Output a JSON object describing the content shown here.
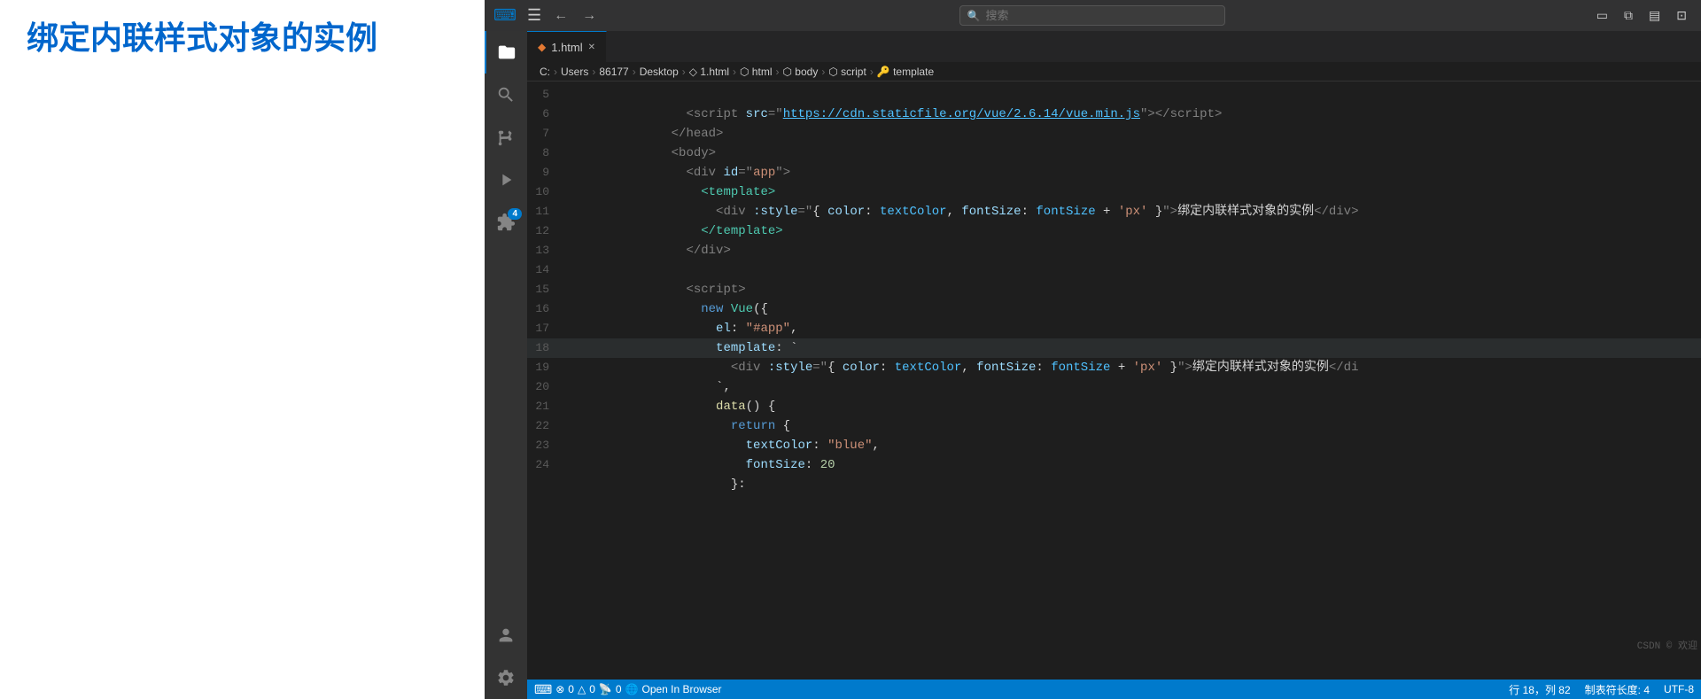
{
  "title": {
    "text": "绑定内联样式对象的实例"
  },
  "vscode": {
    "tab": {
      "icon": "◆",
      "label": "1.html",
      "close": "✕"
    },
    "breadcrumb": {
      "parts": [
        "C:",
        "Users",
        "86177",
        "Desktop",
        "1.html",
        "html",
        "body",
        "script",
        "template"
      ]
    },
    "search": {
      "placeholder": "搜索"
    },
    "lines": [
      {
        "num": 5,
        "content": ""
      },
      {
        "num": 6,
        "content": ""
      },
      {
        "num": 7,
        "content": ""
      },
      {
        "num": 8,
        "content": ""
      },
      {
        "num": 9,
        "content": ""
      },
      {
        "num": 10,
        "content": ""
      },
      {
        "num": 11,
        "content": ""
      },
      {
        "num": 12,
        "content": ""
      },
      {
        "num": 13,
        "content": ""
      },
      {
        "num": 14,
        "content": ""
      },
      {
        "num": 15,
        "content": ""
      },
      {
        "num": 16,
        "content": ""
      },
      {
        "num": 17,
        "content": ""
      },
      {
        "num": 18,
        "content": ""
      },
      {
        "num": 19,
        "content": ""
      },
      {
        "num": 20,
        "content": ""
      },
      {
        "num": 21,
        "content": ""
      },
      {
        "num": 22,
        "content": ""
      },
      {
        "num": 23,
        "content": ""
      },
      {
        "num": 24,
        "content": ""
      }
    ],
    "statusbar": {
      "errors": "0",
      "warnings": "0",
      "info": "0",
      "ports": "0",
      "openInBrowser": "Open In Browser",
      "row": "行 18，列 82",
      "tabSize": "制表符长度: 4",
      "encoding": "UTF-8"
    }
  }
}
